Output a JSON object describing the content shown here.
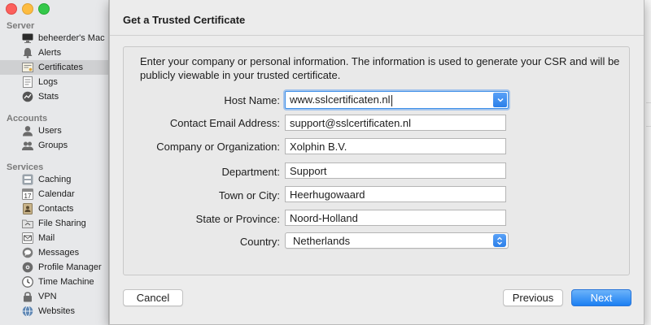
{
  "window": {
    "controls": [
      "close",
      "minimize",
      "zoom"
    ]
  },
  "sidebar": {
    "sections": [
      {
        "header": "Server",
        "items": [
          {
            "label": "beheerder's Mac",
            "icon": "mac-icon",
            "selected": false
          },
          {
            "label": "Alerts",
            "icon": "alerts-icon",
            "selected": false
          },
          {
            "label": "Certificates",
            "icon": "certificates-icon",
            "selected": true
          },
          {
            "label": "Logs",
            "icon": "logs-icon",
            "selected": false
          },
          {
            "label": "Stats",
            "icon": "stats-icon",
            "selected": false
          }
        ]
      },
      {
        "header": "Accounts",
        "items": [
          {
            "label": "Users",
            "icon": "user-icon",
            "selected": false
          },
          {
            "label": "Groups",
            "icon": "groups-icon",
            "selected": false
          }
        ]
      },
      {
        "header": "Services",
        "items": [
          {
            "label": "Caching",
            "icon": "caching-icon",
            "selected": false
          },
          {
            "label": "Calendar",
            "icon": "calendar-icon",
            "selected": false
          },
          {
            "label": "Contacts",
            "icon": "contacts-icon",
            "selected": false
          },
          {
            "label": "File Sharing",
            "icon": "file-sharing-icon",
            "selected": false
          },
          {
            "label": "Mail",
            "icon": "mail-icon",
            "selected": false
          },
          {
            "label": "Messages",
            "icon": "messages-icon",
            "selected": false
          },
          {
            "label": "Profile Manager",
            "icon": "profile-manager-icon",
            "selected": false
          },
          {
            "label": "Time Machine",
            "icon": "time-machine-icon",
            "selected": false
          },
          {
            "label": "VPN",
            "icon": "vpn-icon",
            "selected": false
          },
          {
            "label": "Websites",
            "icon": "websites-icon",
            "selected": false
          }
        ]
      }
    ]
  },
  "dialog": {
    "title": "Get a Trusted Certificate",
    "description": "Enter your company or personal information. The information is used to generate your CSR and will be publicly viewable in your trusted certificate.",
    "fields": {
      "host_name": {
        "label": "Host Name:",
        "value": "www.sslcertificaten.nl"
      },
      "contact_email": {
        "label": "Contact Email Address:",
        "value": "support@sslcertificaten.nl"
      },
      "company": {
        "label": "Company or Organization:",
        "value": "Xolphin B.V."
      },
      "department": {
        "label": "Department:",
        "value": "Support"
      },
      "town": {
        "label": "Town or City:",
        "value": "Heerhugowaard"
      },
      "state": {
        "label": "State or Province:",
        "value": "Noord-Holland"
      },
      "country": {
        "label": "Country:",
        "value": "Netherlands"
      }
    },
    "buttons": {
      "cancel": "Cancel",
      "previous": "Previous",
      "next": "Next"
    }
  },
  "colors": {
    "accent": "#1c7ff2",
    "focus_ring": "#3d8fe8",
    "sidebar_bg": "#e7e8ea",
    "sidebar_selected": "#cfd0d2",
    "traffic_red": "#fc605c",
    "traffic_yellow": "#fdbc40",
    "traffic_green": "#34c84a"
  }
}
